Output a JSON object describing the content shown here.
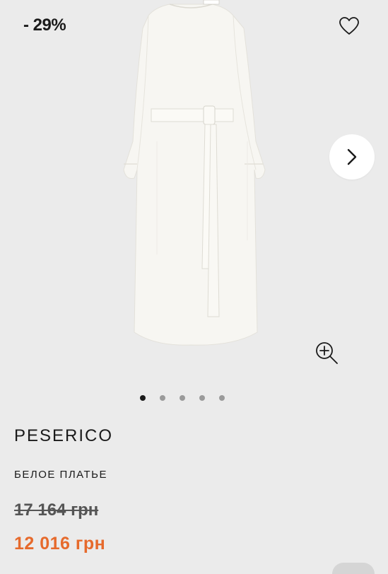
{
  "product": {
    "discount": "- 29%",
    "brand": "PESERICO",
    "name": "БЕЛОЕ ПЛАТЬЕ",
    "old_price": "17 164 грн",
    "new_price": "12 016 грн",
    "image_count": 5,
    "active_image": 0
  },
  "icons": {
    "wishlist": "heart-icon",
    "next": "chevron-right-icon",
    "zoom": "zoom-in-icon"
  },
  "colors": {
    "background": "#ebebeb",
    "sale_price": "#e66a2c",
    "active_dot": "#1a1a1a",
    "inactive_dot": "#9a9a9a"
  }
}
